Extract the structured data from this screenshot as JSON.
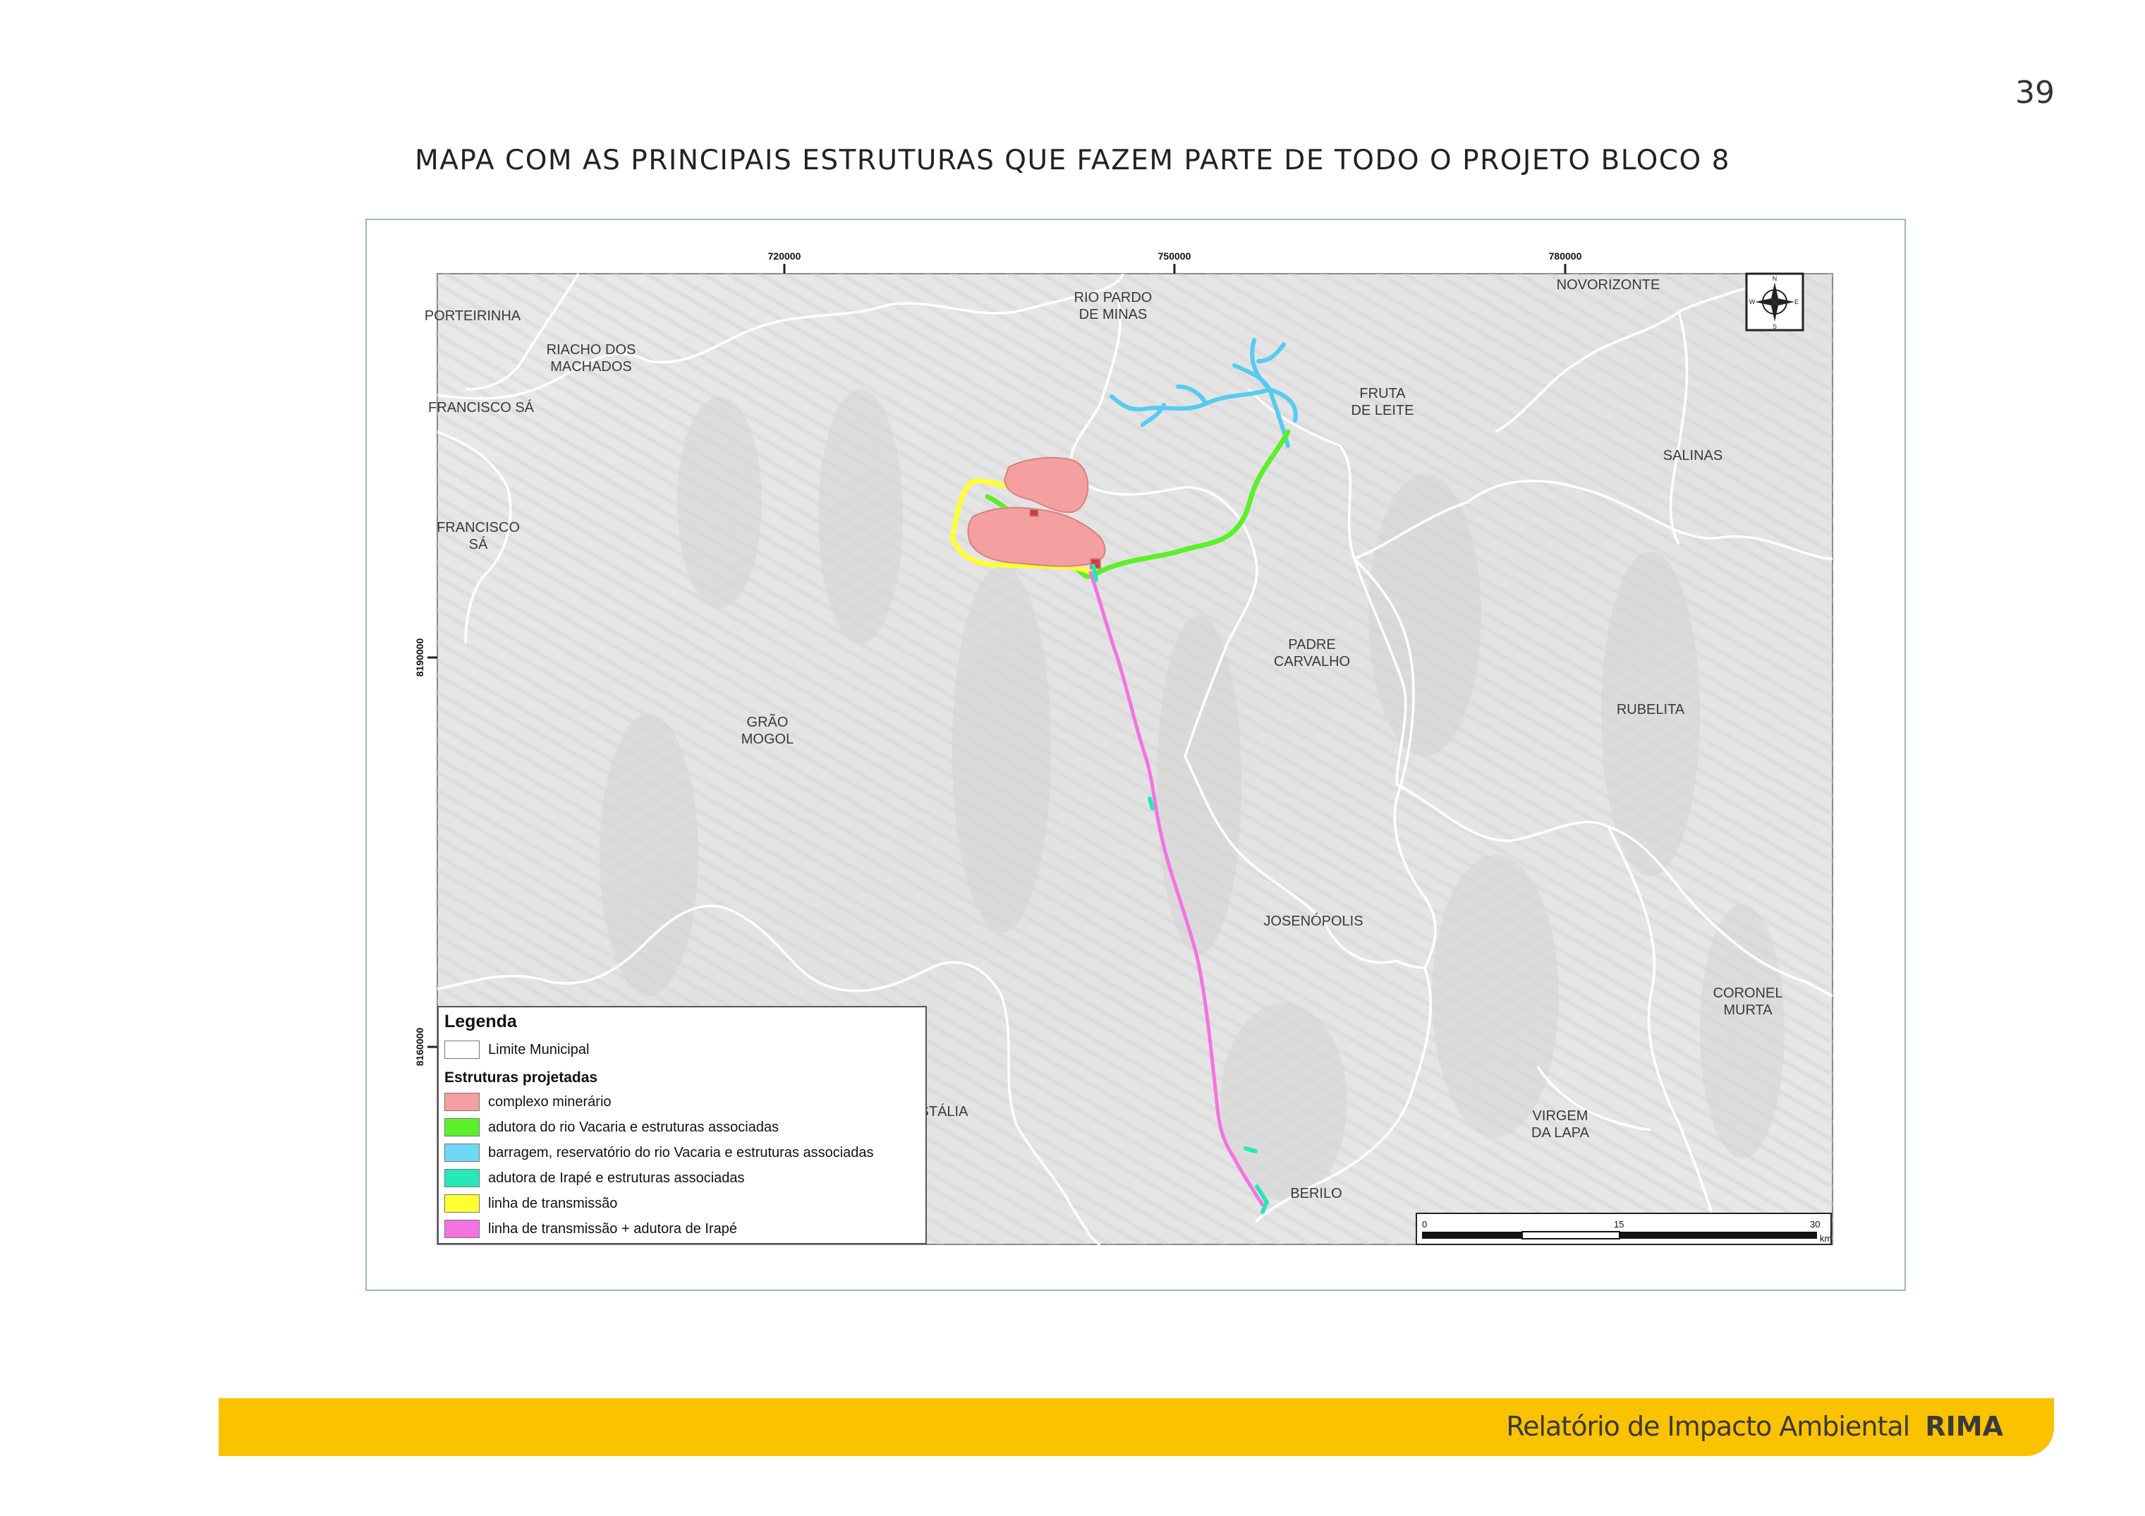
{
  "page_number": "39",
  "title": "MAPA COM AS PRINCIPAIS ESTRUTURAS QUE FAZEM PARTE DE TODO O PROJETO BLOCO 8",
  "map": {
    "x_ticks": [
      "720000",
      "750000",
      "780000"
    ],
    "y_ticks": [
      "8190000",
      "8160000"
    ],
    "north_arrow": {
      "icon": "compass-rose-icon",
      "letters": [
        "N",
        "E",
        "S",
        "W"
      ]
    },
    "places": [
      {
        "id": "porteirinha",
        "label": "PORTEIRINHA"
      },
      {
        "id": "rio-pardo",
        "label": "RIO PARDO\nDE MINAS"
      },
      {
        "id": "novorizonte",
        "label": "NOVORIZONTE"
      },
      {
        "id": "riacho",
        "label": "RIACHO DOS\nMACHADOS"
      },
      {
        "id": "francisco-sa-1",
        "label": "FRANCISCO SÁ"
      },
      {
        "id": "fruta-de-leite",
        "label": "FRUTA\nDE LEITE"
      },
      {
        "id": "salinas",
        "label": "SALINAS"
      },
      {
        "id": "francisco-sa-2",
        "label": "FRANCISCO\nSÁ"
      },
      {
        "id": "padre-carvalho",
        "label": "PADRE\nCARVALHO"
      },
      {
        "id": "rubelita",
        "label": "RUBELITA"
      },
      {
        "id": "grao-mogol",
        "label": "GRÃO\nMOGOL"
      },
      {
        "id": "josenopolis",
        "label": "JOSENÓPOLIS"
      },
      {
        "id": "coronel-murta",
        "label": "CORONEL\nMURTA"
      },
      {
        "id": "cristalia",
        "label": "STÁLIA"
      },
      {
        "id": "virgem-da-lapa",
        "label": "VIRGEM\nDA LAPA"
      },
      {
        "id": "berilo",
        "label": "BERILO"
      }
    ],
    "scale_bar": {
      "labels": [
        "0",
        "15",
        "30"
      ],
      "unit": "km"
    },
    "legend": {
      "title": "Legenda",
      "boundary_label": "Limite Municipal",
      "subtitle": "Estruturas projetadas",
      "items": [
        {
          "label": "complexo minerário",
          "color": "#f4a0a0"
        },
        {
          "label": "adutora do rio Vacaria e estruturas associadas",
          "color": "#5cf02a"
        },
        {
          "label": "barragem, reservatório do rio Vacaria e estruturas associadas",
          "color": "#6fd8f5"
        },
        {
          "label": "adutora de Irapé e estruturas associadas",
          "color": "#27e8b8"
        },
        {
          "label": "linha de transmissão",
          "color": "#ffff33"
        },
        {
          "label": "linha de transmissão + adutora de Irapé",
          "color": "#f373e0"
        }
      ]
    }
  },
  "footer": {
    "text": "Relatório de Impacto Ambiental",
    "brand": "RIMA",
    "color": "#fbc200"
  }
}
